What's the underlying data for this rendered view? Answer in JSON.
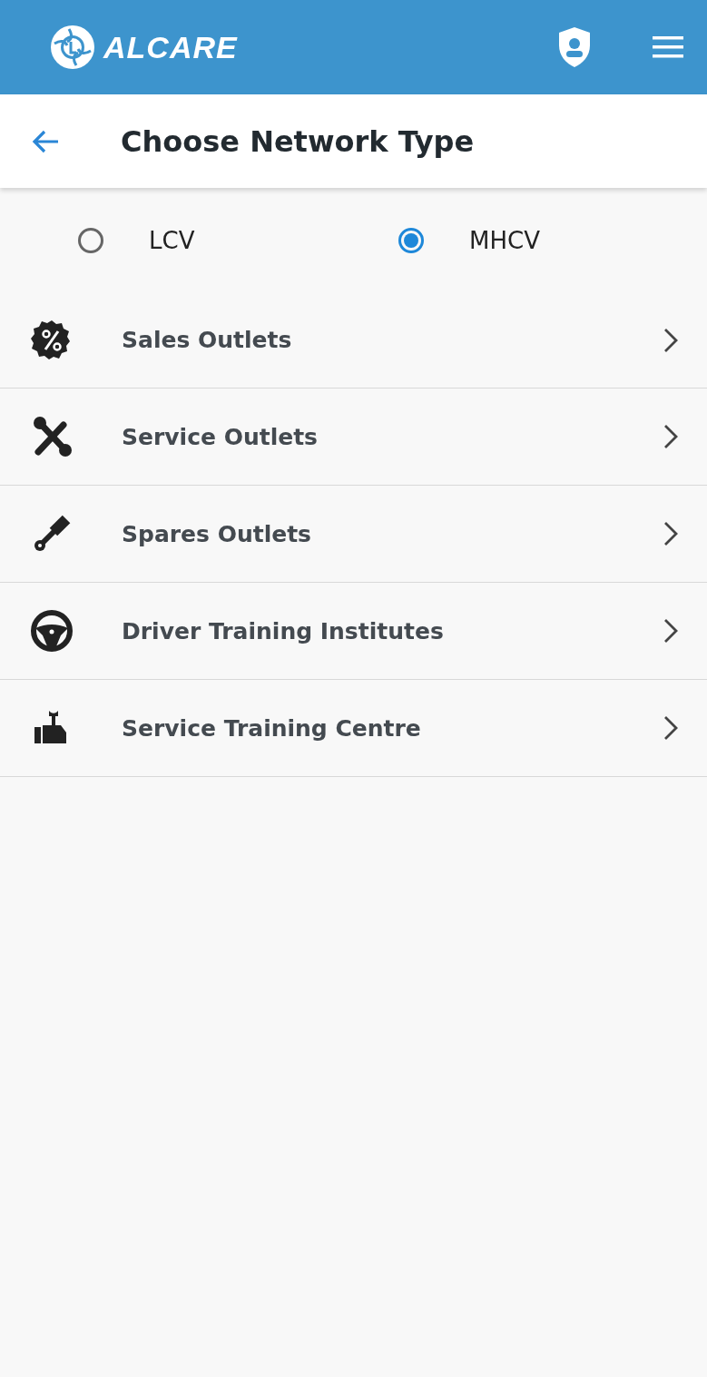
{
  "header": {
    "logo_text": "ALCARE"
  },
  "title_bar": {
    "title": "Choose Network Type"
  },
  "network_types": [
    {
      "label": "LCV",
      "selected": false
    },
    {
      "label": "MHCV",
      "selected": true
    }
  ],
  "menu_items": [
    {
      "kind": "sales",
      "label": "Sales Outlets"
    },
    {
      "kind": "service",
      "label": "Service Outlets"
    },
    {
      "kind": "spares",
      "label": "Spares Outlets"
    },
    {
      "kind": "driver",
      "label": "Driver Training Institutes"
    },
    {
      "kind": "training",
      "label": "Service Training Centre"
    }
  ]
}
